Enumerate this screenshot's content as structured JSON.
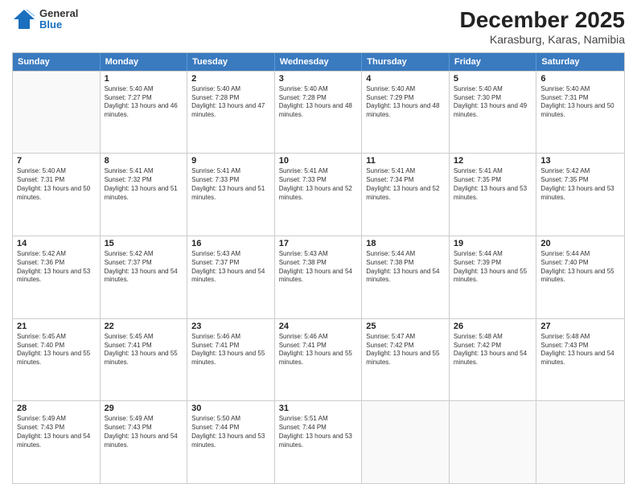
{
  "header": {
    "logo": {
      "general": "General",
      "blue": "Blue"
    },
    "title": "December 2025",
    "location": "Karasburg, Karas, Namibia"
  },
  "days": [
    "Sunday",
    "Monday",
    "Tuesday",
    "Wednesday",
    "Thursday",
    "Friday",
    "Saturday"
  ],
  "rows": [
    [
      {
        "day": "",
        "empty": true
      },
      {
        "day": "1",
        "sunrise": "Sunrise: 5:40 AM",
        "sunset": "Sunset: 7:27 PM",
        "daylight": "Daylight: 13 hours and 46 minutes."
      },
      {
        "day": "2",
        "sunrise": "Sunrise: 5:40 AM",
        "sunset": "Sunset: 7:28 PM",
        "daylight": "Daylight: 13 hours and 47 minutes."
      },
      {
        "day": "3",
        "sunrise": "Sunrise: 5:40 AM",
        "sunset": "Sunset: 7:28 PM",
        "daylight": "Daylight: 13 hours and 48 minutes."
      },
      {
        "day": "4",
        "sunrise": "Sunrise: 5:40 AM",
        "sunset": "Sunset: 7:29 PM",
        "daylight": "Daylight: 13 hours and 48 minutes."
      },
      {
        "day": "5",
        "sunrise": "Sunrise: 5:40 AM",
        "sunset": "Sunset: 7:30 PM",
        "daylight": "Daylight: 13 hours and 49 minutes."
      },
      {
        "day": "6",
        "sunrise": "Sunrise: 5:40 AM",
        "sunset": "Sunset: 7:31 PM",
        "daylight": "Daylight: 13 hours and 50 minutes."
      }
    ],
    [
      {
        "day": "7",
        "sunrise": "Sunrise: 5:40 AM",
        "sunset": "Sunset: 7:31 PM",
        "daylight": "Daylight: 13 hours and 50 minutes."
      },
      {
        "day": "8",
        "sunrise": "Sunrise: 5:41 AM",
        "sunset": "Sunset: 7:32 PM",
        "daylight": "Daylight: 13 hours and 51 minutes."
      },
      {
        "day": "9",
        "sunrise": "Sunrise: 5:41 AM",
        "sunset": "Sunset: 7:33 PM",
        "daylight": "Daylight: 13 hours and 51 minutes."
      },
      {
        "day": "10",
        "sunrise": "Sunrise: 5:41 AM",
        "sunset": "Sunset: 7:33 PM",
        "daylight": "Daylight: 13 hours and 52 minutes."
      },
      {
        "day": "11",
        "sunrise": "Sunrise: 5:41 AM",
        "sunset": "Sunset: 7:34 PM",
        "daylight": "Daylight: 13 hours and 52 minutes."
      },
      {
        "day": "12",
        "sunrise": "Sunrise: 5:41 AM",
        "sunset": "Sunset: 7:35 PM",
        "daylight": "Daylight: 13 hours and 53 minutes."
      },
      {
        "day": "13",
        "sunrise": "Sunrise: 5:42 AM",
        "sunset": "Sunset: 7:35 PM",
        "daylight": "Daylight: 13 hours and 53 minutes."
      }
    ],
    [
      {
        "day": "14",
        "sunrise": "Sunrise: 5:42 AM",
        "sunset": "Sunset: 7:36 PM",
        "daylight": "Daylight: 13 hours and 53 minutes."
      },
      {
        "day": "15",
        "sunrise": "Sunrise: 5:42 AM",
        "sunset": "Sunset: 7:37 PM",
        "daylight": "Daylight: 13 hours and 54 minutes."
      },
      {
        "day": "16",
        "sunrise": "Sunrise: 5:43 AM",
        "sunset": "Sunset: 7:37 PM",
        "daylight": "Daylight: 13 hours and 54 minutes."
      },
      {
        "day": "17",
        "sunrise": "Sunrise: 5:43 AM",
        "sunset": "Sunset: 7:38 PM",
        "daylight": "Daylight: 13 hours and 54 minutes."
      },
      {
        "day": "18",
        "sunrise": "Sunrise: 5:44 AM",
        "sunset": "Sunset: 7:38 PM",
        "daylight": "Daylight: 13 hours and 54 minutes."
      },
      {
        "day": "19",
        "sunrise": "Sunrise: 5:44 AM",
        "sunset": "Sunset: 7:39 PM",
        "daylight": "Daylight: 13 hours and 55 minutes."
      },
      {
        "day": "20",
        "sunrise": "Sunrise: 5:44 AM",
        "sunset": "Sunset: 7:40 PM",
        "daylight": "Daylight: 13 hours and 55 minutes."
      }
    ],
    [
      {
        "day": "21",
        "sunrise": "Sunrise: 5:45 AM",
        "sunset": "Sunset: 7:40 PM",
        "daylight": "Daylight: 13 hours and 55 minutes."
      },
      {
        "day": "22",
        "sunrise": "Sunrise: 5:45 AM",
        "sunset": "Sunset: 7:41 PM",
        "daylight": "Daylight: 13 hours and 55 minutes."
      },
      {
        "day": "23",
        "sunrise": "Sunrise: 5:46 AM",
        "sunset": "Sunset: 7:41 PM",
        "daylight": "Daylight: 13 hours and 55 minutes."
      },
      {
        "day": "24",
        "sunrise": "Sunrise: 5:46 AM",
        "sunset": "Sunset: 7:41 PM",
        "daylight": "Daylight: 13 hours and 55 minutes."
      },
      {
        "day": "25",
        "sunrise": "Sunrise: 5:47 AM",
        "sunset": "Sunset: 7:42 PM",
        "daylight": "Daylight: 13 hours and 55 minutes."
      },
      {
        "day": "26",
        "sunrise": "Sunrise: 5:48 AM",
        "sunset": "Sunset: 7:42 PM",
        "daylight": "Daylight: 13 hours and 54 minutes."
      },
      {
        "day": "27",
        "sunrise": "Sunrise: 5:48 AM",
        "sunset": "Sunset: 7:43 PM",
        "daylight": "Daylight: 13 hours and 54 minutes."
      }
    ],
    [
      {
        "day": "28",
        "sunrise": "Sunrise: 5:49 AM",
        "sunset": "Sunset: 7:43 PM",
        "daylight": "Daylight: 13 hours and 54 minutes."
      },
      {
        "day": "29",
        "sunrise": "Sunrise: 5:49 AM",
        "sunset": "Sunset: 7:43 PM",
        "daylight": "Daylight: 13 hours and 54 minutes."
      },
      {
        "day": "30",
        "sunrise": "Sunrise: 5:50 AM",
        "sunset": "Sunset: 7:44 PM",
        "daylight": "Daylight: 13 hours and 53 minutes."
      },
      {
        "day": "31",
        "sunrise": "Sunrise: 5:51 AM",
        "sunset": "Sunset: 7:44 PM",
        "daylight": "Daylight: 13 hours and 53 minutes."
      },
      {
        "day": "",
        "empty": true
      },
      {
        "day": "",
        "empty": true
      },
      {
        "day": "",
        "empty": true
      }
    ]
  ]
}
